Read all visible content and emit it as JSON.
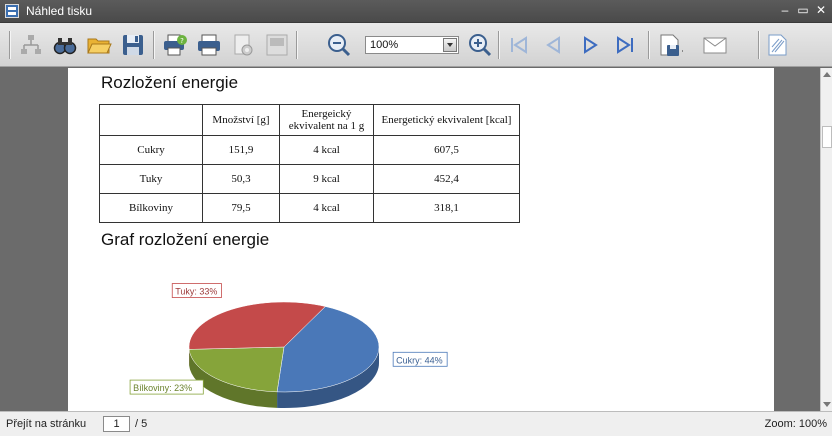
{
  "window": {
    "title": "Náhled tisku"
  },
  "toolbar": {
    "zoom_value": "100%",
    "buttons": [
      "document-map-icon",
      "find-icon",
      "open-icon",
      "save-icon",
      "page-setup-icon",
      "print-icon",
      "print-settings-icon",
      "export-icon",
      "zoom-out-icon",
      "zoom-in-icon",
      "first-page-icon",
      "previous-page-icon",
      "next-page-icon",
      "last-page-icon",
      "save-as-icon",
      "email-icon",
      "watermark-icon"
    ]
  },
  "document": {
    "heading1": "Rozložení energie",
    "heading2": "Graf rozložení energie",
    "table": {
      "headers": [
        "",
        "Množství [g]",
        "Energeický ekvivalent na 1 g",
        "Energetický ekvivalent [kcal]"
      ],
      "header_lines": [
        "Energeický",
        "ekvivalent na 1 g"
      ],
      "rows": [
        [
          "Cukry",
          "151,9",
          "4 kcal",
          "607,5"
        ],
        [
          "Tuky",
          "50,3",
          "9 kcal",
          "452,4"
        ],
        [
          "Bílkoviny",
          "79,5",
          "4 kcal",
          "318,1"
        ]
      ]
    }
  },
  "chart_data": {
    "type": "pie",
    "title": "",
    "categories": [
      "Cukry",
      "Bílkoviny",
      "Tuky"
    ],
    "values": [
      44,
      23,
      33
    ],
    "labels": [
      "Cukry: 44%",
      "Bílkoviny: 23%",
      "Tuky: 33%"
    ],
    "colors": [
      "#4a78b8",
      "#86a43a",
      "#c44a4a"
    ]
  },
  "status": {
    "goto_label": "Přejít na stránku",
    "page_current": "1",
    "page_total": "/ 5",
    "zoom": "Zoom: 100%"
  },
  "colors": {
    "titlebar": "#4f4f4f",
    "viewer_bg": "#6b6b6b"
  }
}
